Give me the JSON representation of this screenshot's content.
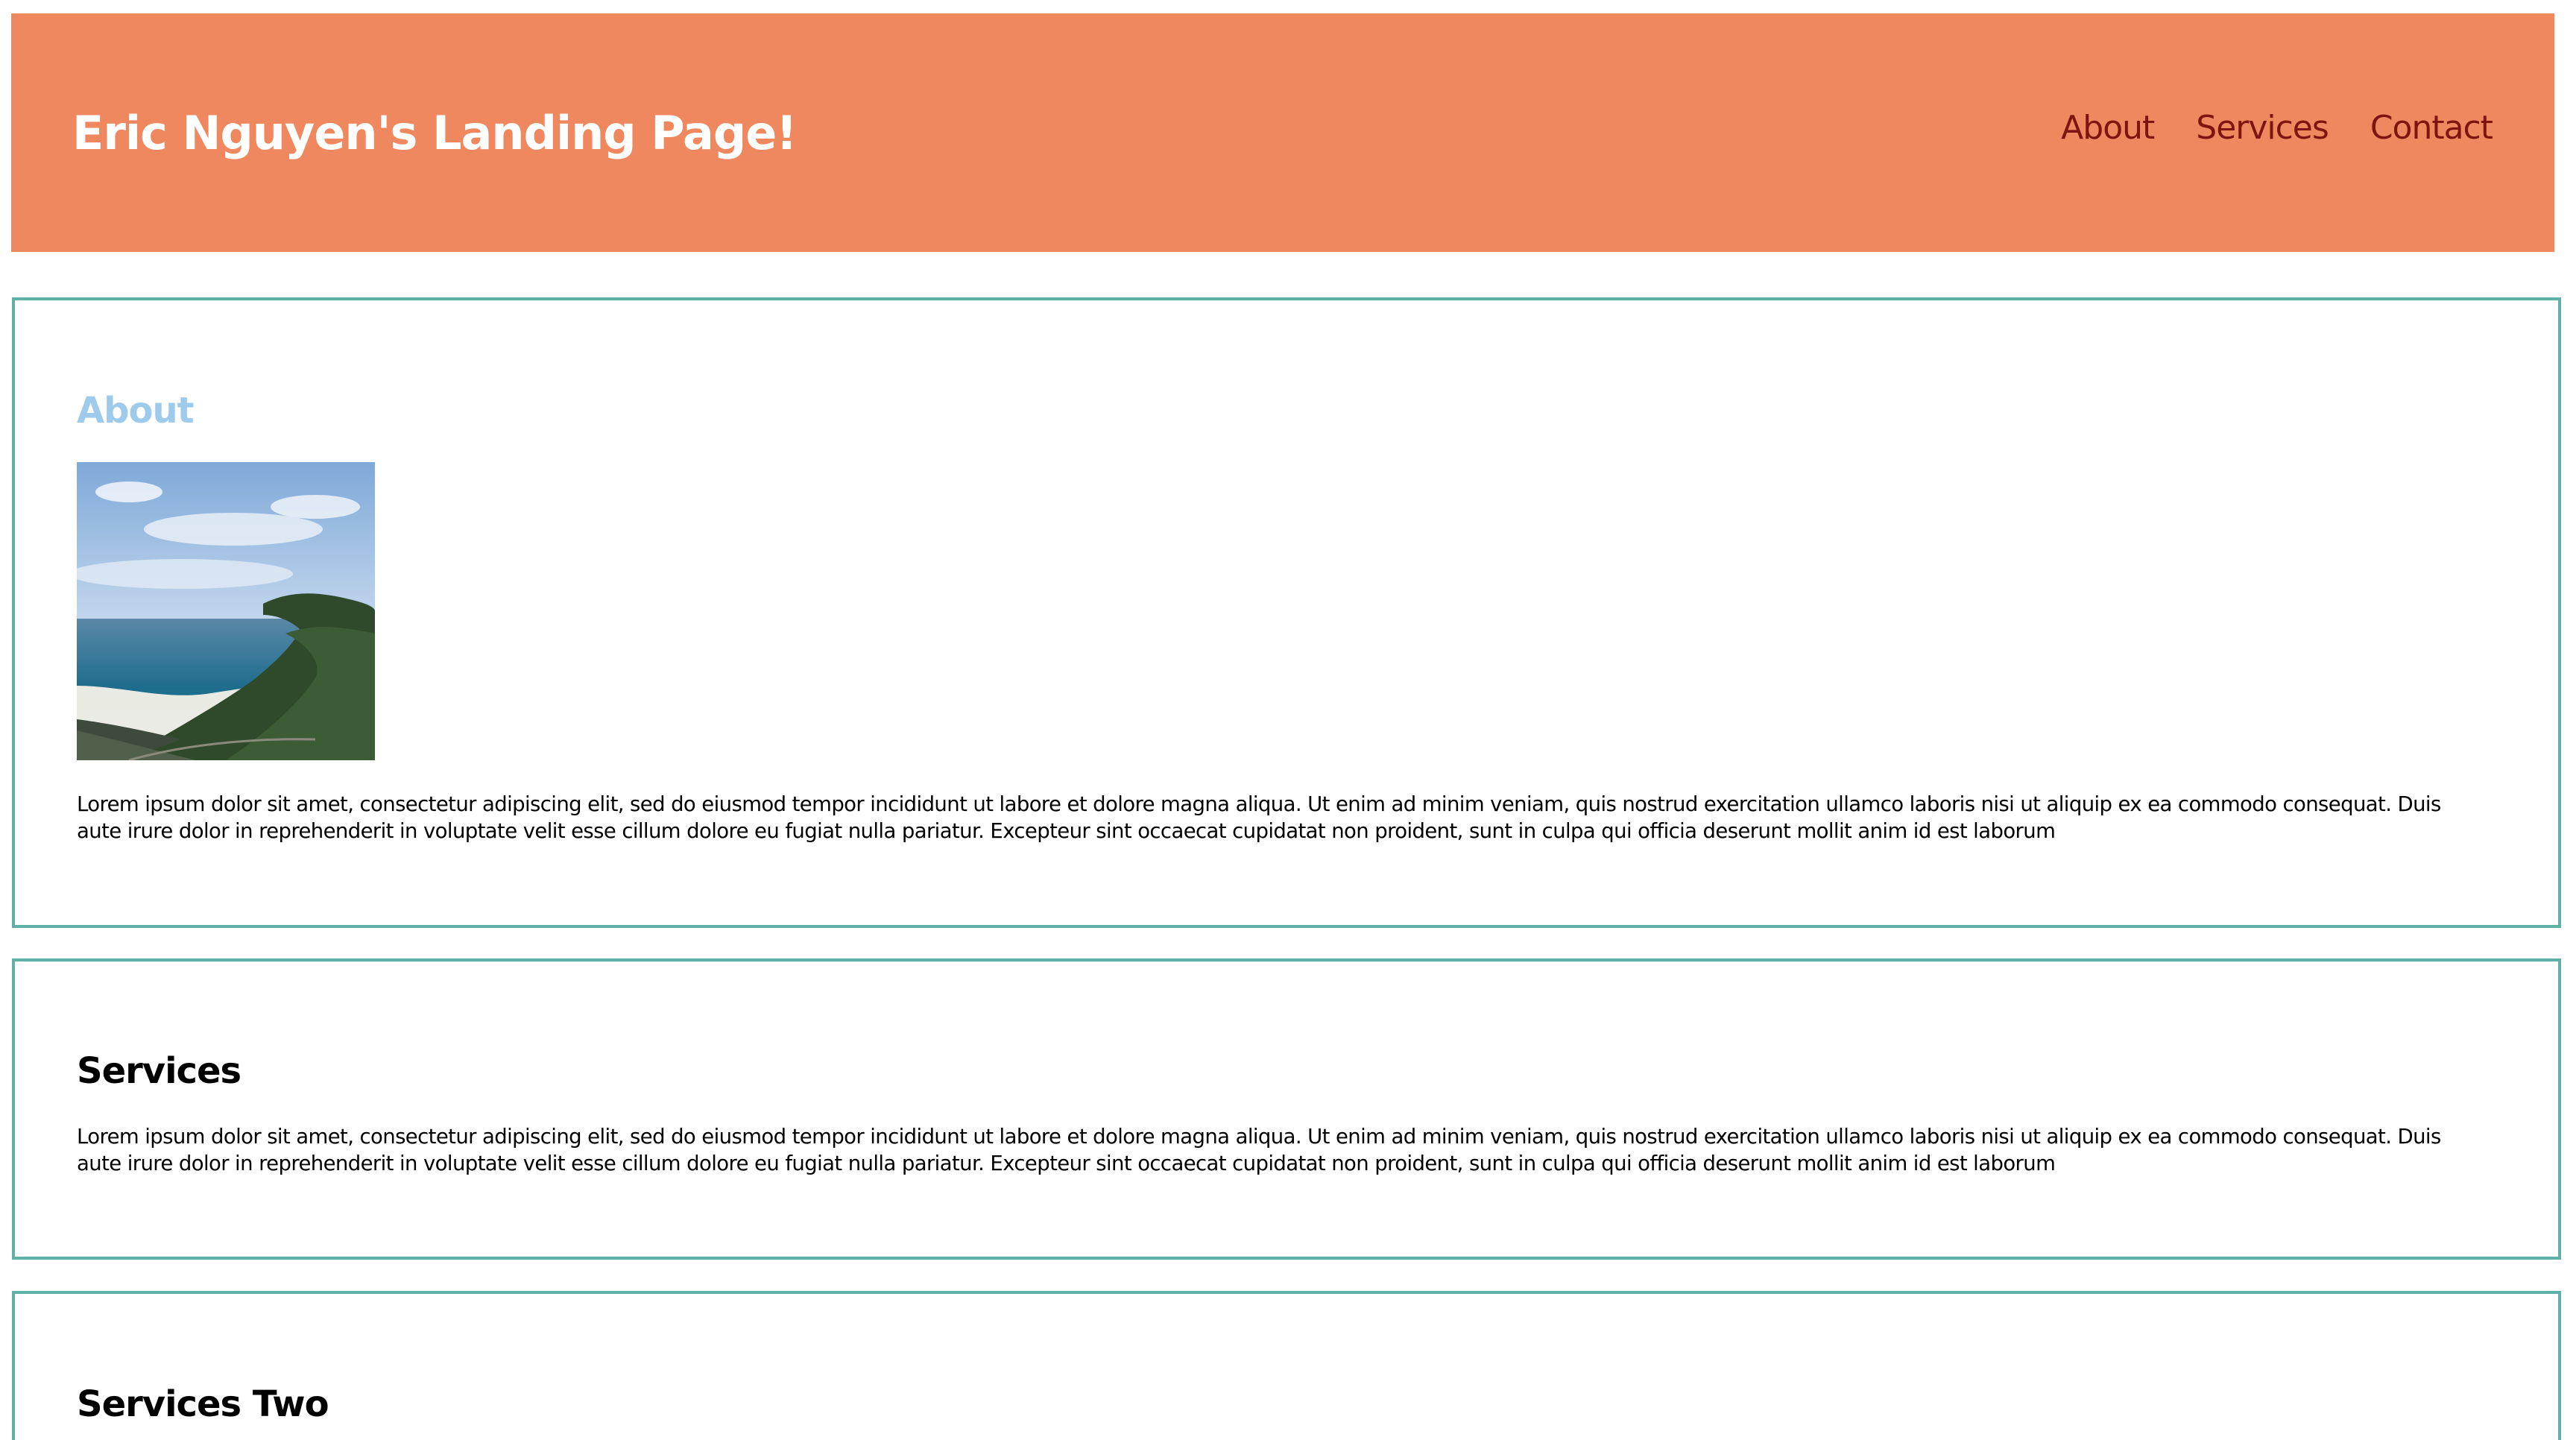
{
  "header": {
    "title": "Eric Nguyen's Landing Page!",
    "background_color": "#ef885e",
    "nav": [
      {
        "label": "About"
      },
      {
        "label": "Services"
      },
      {
        "label": "Contact"
      }
    ],
    "nav_color": "#7d1410"
  },
  "sections": {
    "about": {
      "heading": "About",
      "heading_color": "#9ecbeb",
      "image": "coastal-landscape-photo",
      "text": "Lorem ipsum dolor sit amet, consectetur adipiscing elit, sed do eiusmod tempor incididunt ut labore et dolore magna aliqua. Ut enim ad minim veniam, quis nostrud exercitation ullamco laboris nisi ut aliquip ex ea commodo consequat. Duis aute irure dolor in reprehenderit in voluptate velit esse cillum dolore eu fugiat nulla pariatur. Excepteur sint occaecat cupidatat non proident, sunt in culpa qui officia deserunt mollit anim id est laborum"
    },
    "services": {
      "heading": "Services",
      "text": "Lorem ipsum dolor sit amet, consectetur adipiscing elit, sed do eiusmod tempor incididunt ut labore et dolore magna aliqua. Ut enim ad minim veniam, quis nostrud exercitation ullamco laboris nisi ut aliquip ex ea commodo consequat. Duis aute irure dolor in reprehenderit in voluptate velit esse cillum dolore eu fugiat nulla pariatur. Excepteur sint occaecat cupidatat non proident, sunt in culpa qui officia deserunt mollit anim id est laborum"
    },
    "services_two": {
      "heading": "Services Two"
    },
    "border_color": "#5fb1a8"
  }
}
